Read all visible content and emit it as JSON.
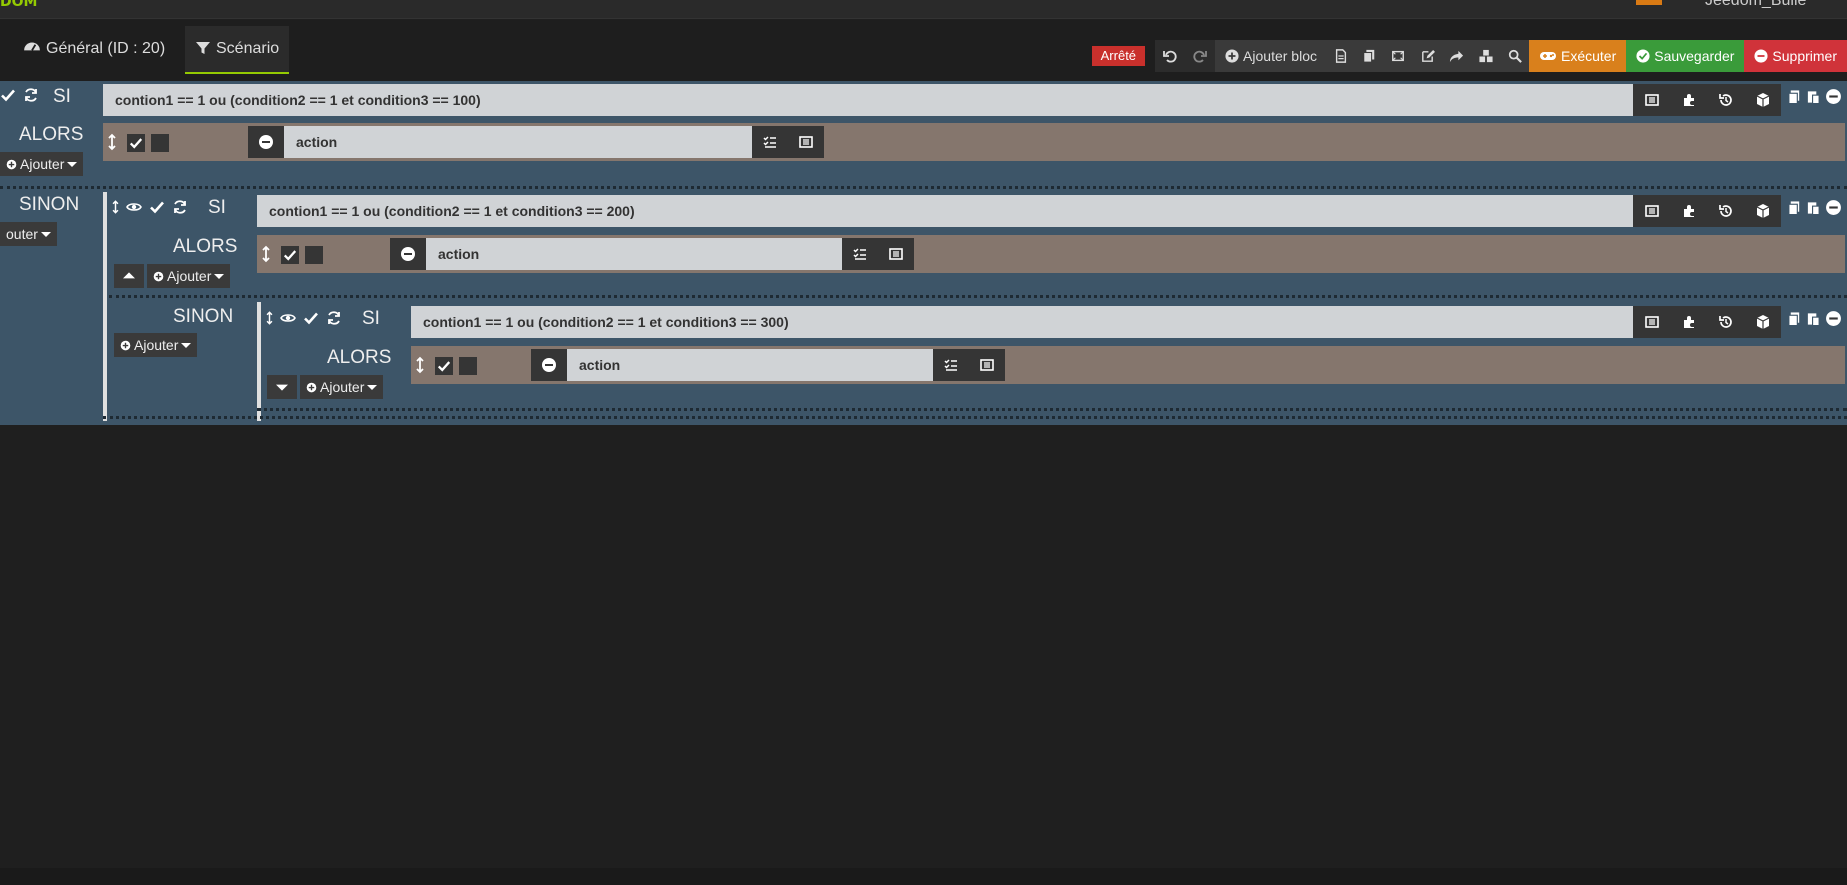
{
  "header": {
    "logo": "DOM",
    "username": "Jeedom_Bulle"
  },
  "tabs": [
    {
      "label": "Général (ID : 20)"
    },
    {
      "label": "Scénario"
    }
  ],
  "toolbar": {
    "status": "Arrêté",
    "add_block": "Ajouter bloc",
    "execute": "Exécuter",
    "save": "Sauvegarder",
    "delete": "Supprimer"
  },
  "colors": {
    "accent": "#94ca02",
    "status": "#c9302c",
    "execute": "#d9801c",
    "save": "#3a9b3a",
    "delete": "#d0333a"
  },
  "blocks": [
    {
      "if_label": "SI",
      "then_label": "ALORS",
      "else_label": "SINON",
      "condition": "contion1 == 1 ou (condition2 == 1 et condition3 == 100)",
      "action": "action",
      "add_label": "Ajouter",
      "else_add_label": "outer"
    },
    {
      "if_label": "SI",
      "then_label": "ALORS",
      "else_label": "SINON",
      "condition": "contion1 == 1 ou (condition2 == 1 et condition3 == 200)",
      "action": "action",
      "add_label": "Ajouter",
      "else_add_label": "Ajouter"
    },
    {
      "if_label": "SI",
      "then_label": "ALORS",
      "condition": "contion1 == 1 ou (condition2 == 1 et condition3 == 300)",
      "action": "action",
      "add_label": "Ajouter"
    }
  ]
}
